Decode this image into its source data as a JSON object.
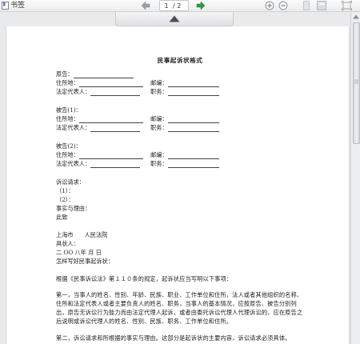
{
  "toolbar": {
    "bookmark_label": "书签",
    "current_page": "1",
    "total_pages": "/ 2"
  },
  "doc": {
    "title": "民事起诉状格式",
    "plaintiff_label": "原告：",
    "address_label": "住所地：",
    "postcode_label": "邮编：",
    "legal_rep_label": "法定代表人：",
    "position_label": "职务：",
    "defendant1_label": "被告(1)：",
    "defendant2_label": "被告(2)：",
    "claims_label": "诉讼请求：",
    "claim1": "（1）：",
    "claim2": "（2）：",
    "facts_label": "事实与理由：",
    "closing": "此致",
    "court_city": "上海市",
    "court_name": "人民法院",
    "signer": "具状人：",
    "date_line": "二 OO 八年  月  日",
    "howto_title": "怎样写好民事起诉状：",
    "para_intro": "根据《民事诉讼法》第１１０条的规定，起诉状应当写明以下事项：",
    "para_one": "第一，当事人的姓名、性别、年龄、民族、职业、工作单位和住所，法人或者其他组织的名称、住所和法定代表人或者主要负责人的姓名、职务，当事人的基本情况，应按原告、被告分别列出，原告无诉讼行为能力而由法定代理人起诉，或者由委托诉讼代理人代理诉讼的，应在原告之后说明或诉讼代理人的姓名、性别、民族、职务、工作单位和住所。",
    "para_two": "第二，诉讼请求和所根据的事实与理由。这部分是起诉状的主要内容，诉讼请求必须具体。"
  }
}
